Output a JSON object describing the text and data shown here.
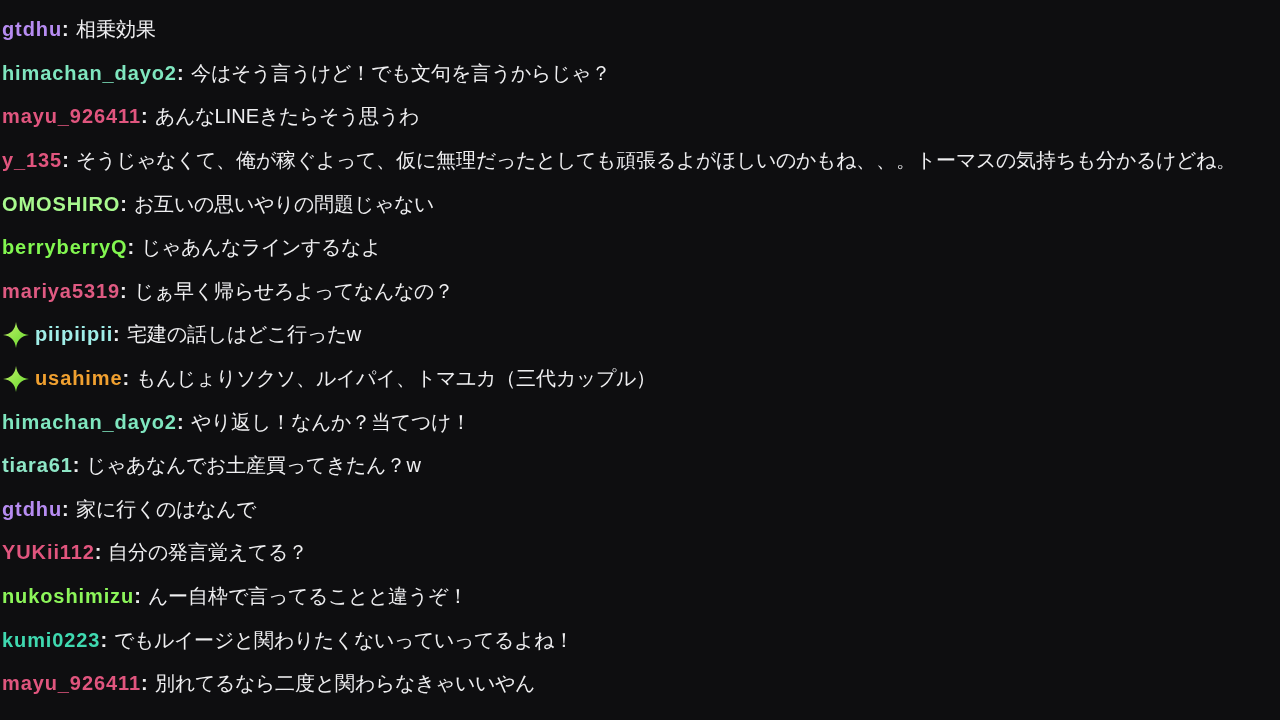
{
  "chat": {
    "messages": [
      {
        "user": "gtdhu",
        "color": "#b78cf2",
        "badge": false,
        "separator": ":",
        "text": "相乗効果"
      },
      {
        "user": "himachan_dayo2",
        "color": "#7fe6bf",
        "badge": false,
        "separator": ":",
        "text": "今はそう言うけど！でも文句を言うからじゃ？"
      },
      {
        "user": "mayu_926411",
        "color": "#e0557e",
        "badge": false,
        "separator": ":",
        "text": "あんなLINEきたらそう思うわ"
      },
      {
        "user": "y_135",
        "color": "#e0557e",
        "badge": false,
        "separator": ":",
        "text": "そうじゃなくて、俺が稼ぐよって、仮に無理だったとしても頑張るよがほしいのかもね、、。トーマスの気持ちも分かるけどね。"
      },
      {
        "user": "OMOSHIRO",
        "color": "#a8f98e",
        "badge": false,
        "separator": ":",
        "text": "お互いの思いやりの問題じゃない"
      },
      {
        "user": "berryberryQ",
        "color": "#82f750",
        "badge": false,
        "separator": ":",
        "text": "じゃあんなラインするなよ"
      },
      {
        "user": "mariya5319",
        "color": "#df5a82",
        "badge": false,
        "separator": ":",
        "text": "じぁ早く帰らせろよってなんなの？"
      },
      {
        "user": "piipiipii",
        "color": "#a0eee8",
        "badge": true,
        "separator": ":",
        "text": "宅建の話しはどこ行ったw"
      },
      {
        "user": "usahime",
        "color": "#f0a030",
        "badge": true,
        "separator": ":",
        "text": "もんじょりソクソ、ルイパイ、トマユカ（三代カップル）"
      },
      {
        "user": "himachan_dayo2",
        "color": "#7fe6bf",
        "badge": false,
        "separator": ":",
        "text": "やり返し！なんか？当てつけ！"
      },
      {
        "user": "tiara61",
        "color": "#8ee6c6",
        "badge": false,
        "separator": ":",
        "text": "じゃあなんでお土産買ってきたん？w"
      },
      {
        "user": "gtdhu",
        "color": "#b78cf2",
        "badge": false,
        "separator": ":",
        "text": "家に行くのはなんで"
      },
      {
        "user": "YUKii112",
        "color": "#e0557e",
        "badge": false,
        "separator": ":",
        "text": "自分の発言覚えてる？"
      },
      {
        "user": "nukoshimizu",
        "color": "#8cf55a",
        "badge": false,
        "separator": ":",
        "text": "んー自枠で言ってることと違うぞ！"
      },
      {
        "user": "kumi0223",
        "color": "#3fd9b0",
        "badge": false,
        "separator": ":",
        "text": "でもルイージと関わりたくないっていってるよね！"
      },
      {
        "user": "mayu_926411",
        "color": "#e0557e",
        "badge": false,
        "separator": ":",
        "text": "別れてるなら二度と関わらなきゃいいやん"
      }
    ]
  }
}
